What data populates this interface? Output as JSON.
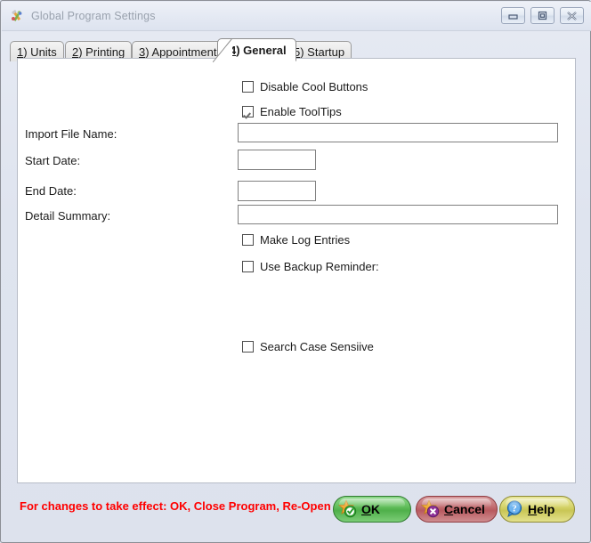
{
  "window": {
    "title": "Global Program Settings",
    "icon": "tools-wrench-icon",
    "buttons": {
      "minimize": "minimize-icon",
      "maximize": "maximize-icon",
      "close": "close-icon"
    }
  },
  "tabs": [
    {
      "prefix": "1",
      "rest": ") Units",
      "label": "1) Units",
      "active": false
    },
    {
      "prefix": "2",
      "rest": ") Printing",
      "label": "2) Printing",
      "active": false
    },
    {
      "prefix": "3",
      "rest": ") Appointment",
      "label": "3) Appointment",
      "active": false
    },
    {
      "prefix": "4",
      "rest": ") General",
      "label": "4) General",
      "active": true
    },
    {
      "prefix": "5",
      "rest": ") Startup",
      "label": "5) Startup",
      "active": false
    }
  ],
  "form": {
    "checkbox_disable_cool_buttons": {
      "label": "Disable Cool Buttons",
      "checked": false
    },
    "checkbox_enable_tooltips": {
      "label": "Enable ToolTips",
      "checked": true
    },
    "import_file_name": {
      "label": "Import File Name:",
      "value": "",
      "placeholder": ""
    },
    "start_date": {
      "label": "Start Date:",
      "value": "",
      "placeholder": ""
    },
    "end_date": {
      "label": "End Date:",
      "value": "",
      "placeholder": ""
    },
    "detail_summary": {
      "label": "Detail Summary:",
      "value": "",
      "placeholder": ""
    },
    "checkbox_make_log_entries": {
      "label": "Make Log Entries",
      "checked": false
    },
    "checkbox_use_backup_reminder": {
      "label": "Use Backup Reminder:",
      "checked": false
    },
    "checkbox_search_case_sensitive": {
      "label": "Search Case Sensiive",
      "checked": false
    }
  },
  "footer": {
    "notice": "For changes to take effect: OK, Close Program, Re-Open",
    "notice_color": "#ff0000",
    "ok": {
      "accesskey": "O",
      "rest": "K",
      "icon": "star-check-icon"
    },
    "cancel": {
      "accesskey": "C",
      "rest": "ancel",
      "icon": "star-x-icon"
    },
    "help": {
      "accesskey": "H",
      "rest": "elp",
      "icon": "question-bubble-icon"
    }
  }
}
